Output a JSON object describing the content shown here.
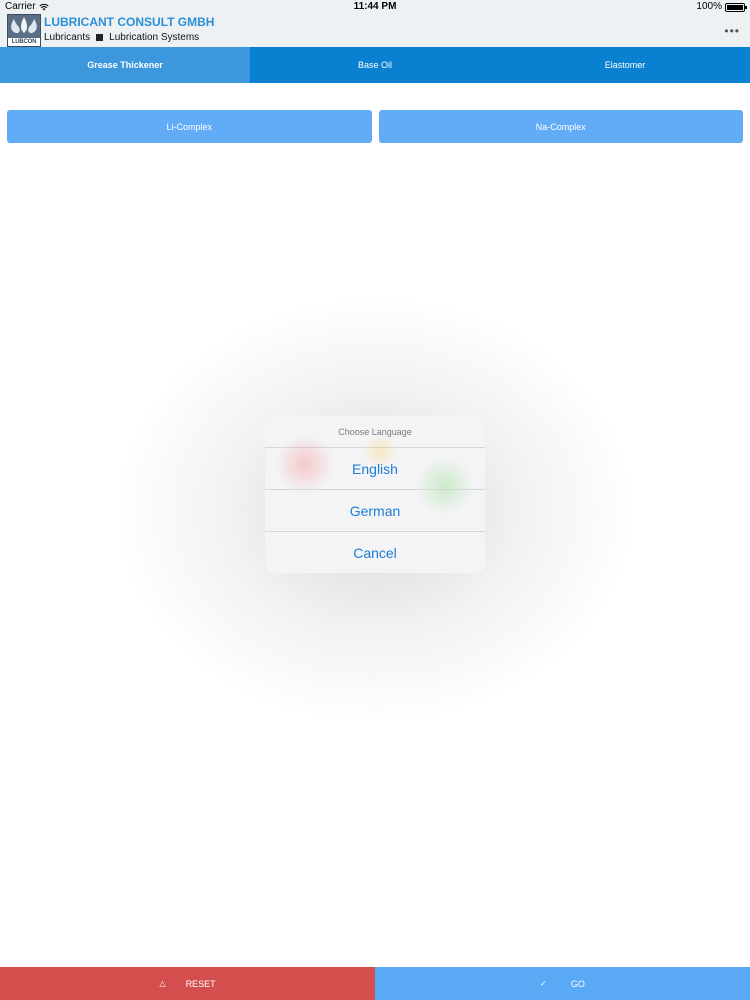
{
  "status": {
    "carrier": "Carrier",
    "time": "11:44 PM",
    "battery": "100%",
    "battery_level": 1.0
  },
  "header": {
    "logo_text": "LUBCON",
    "company": "LUBRICANT CONSULT GMBH",
    "line_left": "Lubricants",
    "line_right": "Lubrication Systems"
  },
  "tabs": [
    {
      "label": "Grease Thickener"
    },
    {
      "label": "Base Oil"
    },
    {
      "label": "Elastomer"
    }
  ],
  "options": [
    {
      "label": "Li-Complex"
    },
    {
      "label": "Na-Complex"
    }
  ],
  "dialog": {
    "title": "Choose Language",
    "items": [
      {
        "label": "English"
      },
      {
        "label": "German"
      },
      {
        "label": "Cancel"
      }
    ]
  },
  "footer": {
    "reset_label": "RESET",
    "go_label": "GO"
  },
  "colors": {
    "tab_bar": "#0a81d0",
    "tab_active": "#3d97dd",
    "option_button": "#61abf7",
    "reset": "#d44e4e",
    "go": "#5aa9f4",
    "brand_blue": "#2a8fd4",
    "dialog_action": "#1b7bd8"
  }
}
